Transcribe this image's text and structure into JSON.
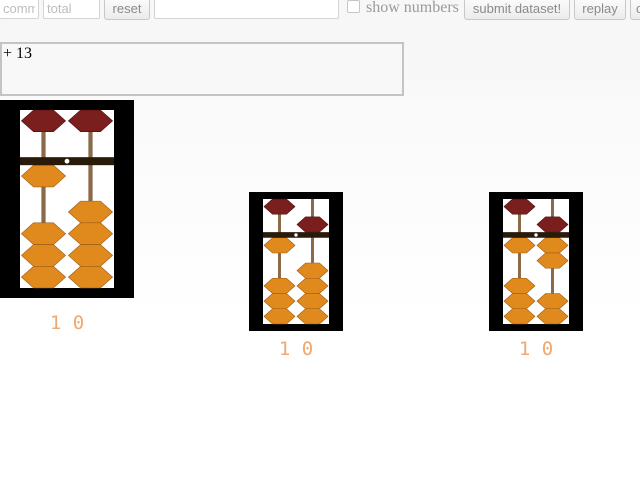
{
  "toolbar": {
    "comment_placeholder": "comm",
    "total_placeholder": "total",
    "reset_label": "reset",
    "text_field_value": "",
    "show_numbers_label": "show numbers",
    "show_numbers_checked": false,
    "submit_label": "submit dataset!",
    "replay_label": "replay",
    "extra_label": "c"
  },
  "expression": "+ 13",
  "colors": {
    "heaven_bead": "#7a1e1e",
    "earth_bead": "#e08a1e",
    "rod": "#8b6a4a",
    "beam": "#2a1a0a",
    "frame": "#000000",
    "readout": "#f0a870"
  },
  "abacuses": [
    {
      "name": "user-abacus",
      "value_text": "1 0",
      "rods": [
        {
          "heaven_active": false,
          "earth_active": 1
        },
        {
          "heaven_active": false,
          "earth_active": 0
        }
      ]
    },
    {
      "name": "target-abacus-1",
      "value_text": "1 0",
      "rods": [
        {
          "heaven_active": false,
          "earth_active": 1
        },
        {
          "heaven_active": true,
          "earth_active": 0
        }
      ]
    },
    {
      "name": "target-abacus-2",
      "value_text": "1 0",
      "rods": [
        {
          "heaven_active": false,
          "earth_active": 1
        },
        {
          "heaven_active": true,
          "earth_active": 2
        }
      ]
    }
  ]
}
